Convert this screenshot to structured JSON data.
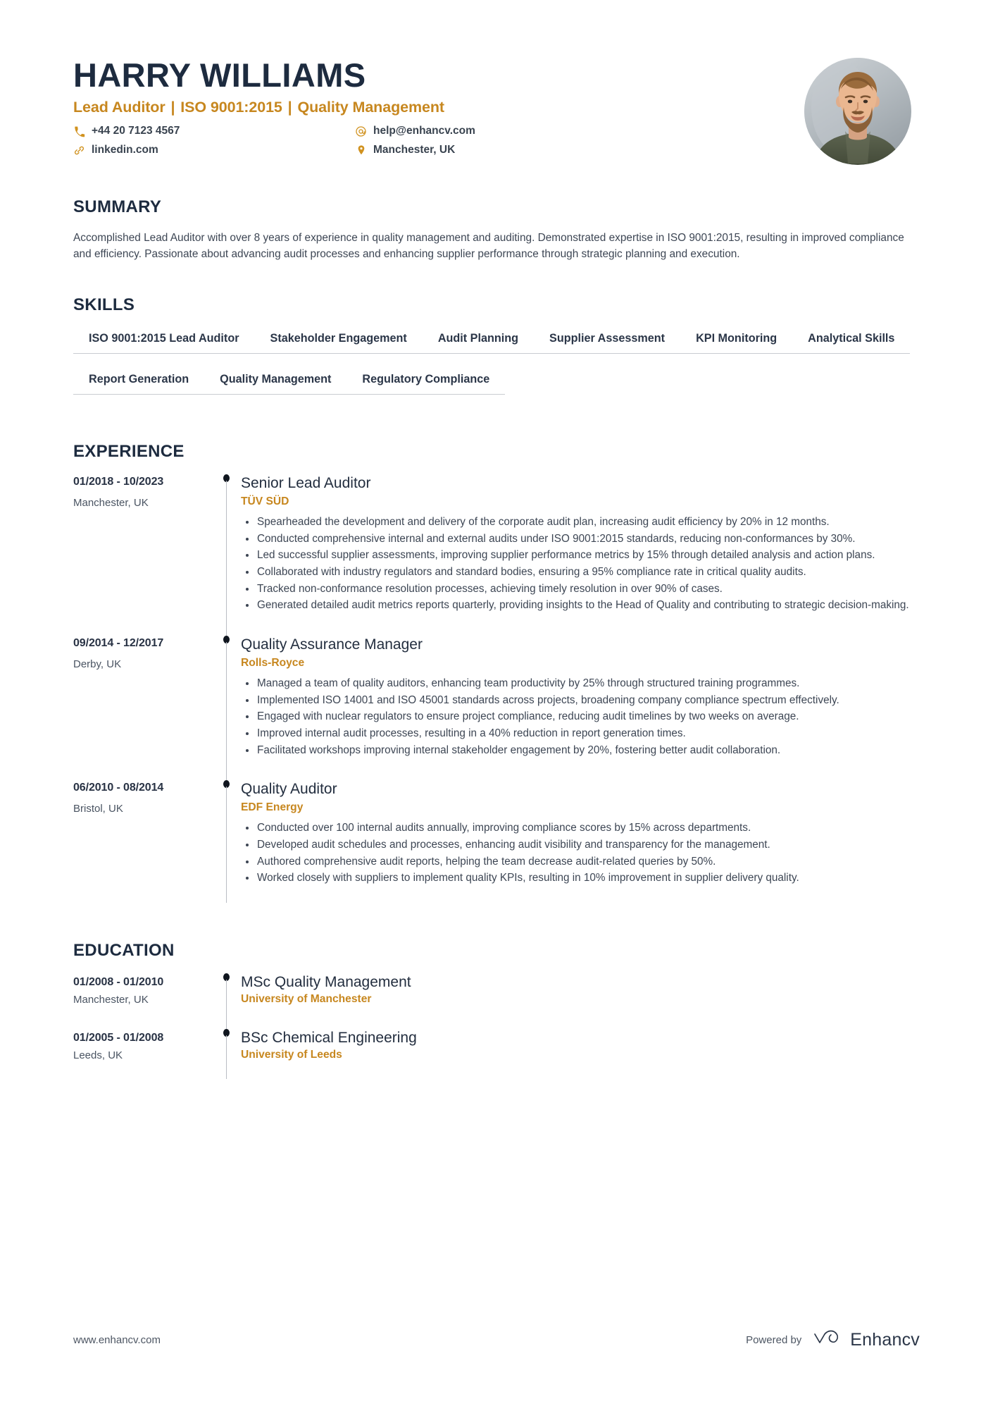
{
  "header": {
    "name": "HARRY WILLIAMS",
    "headline_parts": [
      "Lead Auditor",
      "ISO 9001:2015",
      "Quality Management"
    ],
    "headline_separator": "|",
    "contacts": [
      {
        "icon": "phone-icon",
        "value": "+44 20 7123 4567"
      },
      {
        "icon": "email-icon",
        "value": "help@enhancv.com"
      },
      {
        "icon": "link-icon",
        "value": "linkedin.com"
      },
      {
        "icon": "location-pin-icon",
        "value": "Manchester, UK"
      }
    ],
    "avatar_alt": "profile-photo"
  },
  "summary": {
    "title": "SUMMARY",
    "text": "Accomplished Lead Auditor with over 8 years of experience in quality management and auditing. Demonstrated expertise in ISO 9001:2015, resulting in improved compliance and efficiency. Passionate about advancing audit processes and enhancing supplier performance through strategic planning and execution."
  },
  "skills": {
    "title": "SKILLS",
    "items": [
      "ISO 9001:2015 Lead Auditor",
      "Stakeholder Engagement",
      "Audit Planning",
      "Supplier Assessment",
      "KPI Monitoring",
      "Analytical Skills",
      "Report Generation",
      "Quality Management",
      "Regulatory Compliance"
    ]
  },
  "experience": {
    "title": "EXPERIENCE",
    "entries": [
      {
        "date": "01/2018 - 10/2023",
        "location": "Manchester, UK",
        "role": "Senior Lead Auditor",
        "company": "TÜV SÜD",
        "bullets": [
          "Spearheaded the development and delivery of the corporate audit plan, increasing audit efficiency by 20% in 12 months.",
          "Conducted comprehensive internal and external audits under ISO 9001:2015 standards, reducing non-conformances by 30%.",
          "Led successful supplier assessments, improving supplier performance metrics by 15% through detailed analysis and action plans.",
          "Collaborated with industry regulators and standard bodies, ensuring a 95% compliance rate in critical quality audits.",
          "Tracked non-conformance resolution processes, achieving timely resolution in over 90% of cases.",
          "Generated detailed audit metrics reports quarterly, providing insights to the Head of Quality and contributing to strategic decision-making."
        ]
      },
      {
        "date": "09/2014 - 12/2017",
        "location": "Derby, UK",
        "role": "Quality Assurance Manager",
        "company": "Rolls-Royce",
        "bullets": [
          "Managed a team of quality auditors, enhancing team productivity by 25% through structured training programmes.",
          "Implemented ISO 14001 and ISO 45001 standards across projects, broadening company compliance spectrum effectively.",
          "Engaged with nuclear regulators to ensure project compliance, reducing audit timelines by two weeks on average.",
          "Improved internal audit processes, resulting in a 40% reduction in report generation times.",
          "Facilitated workshops improving internal stakeholder engagement by 20%, fostering better audit collaboration."
        ]
      },
      {
        "date": "06/2010 - 08/2014",
        "location": "Bristol, UK",
        "role": "Quality Auditor",
        "company": "EDF Energy",
        "bullets": [
          "Conducted over 100 internal audits annually, improving compliance scores by 15% across departments.",
          "Developed audit schedules and processes, enhancing audit visibility and transparency for the management.",
          "Authored comprehensive audit reports, helping the team decrease audit-related queries by 50%.",
          "Worked closely with suppliers to implement quality KPIs, resulting in 10% improvement in supplier delivery quality."
        ]
      }
    ]
  },
  "education": {
    "title": "EDUCATION",
    "entries": [
      {
        "date": "01/2008 - 01/2010",
        "location": "Manchester, UK",
        "degree": "MSc Quality Management",
        "institution": "University of Manchester"
      },
      {
        "date": "01/2005 - 01/2008",
        "location": "Leeds, UK",
        "degree": "BSc Chemical Engineering",
        "institution": "University of Leeds"
      }
    ]
  },
  "footer": {
    "website": "www.enhancv.com",
    "powered_by": "Powered by",
    "brand_name": "Enhancv"
  },
  "colors": {
    "accent": "#c7871f",
    "heading": "#1d2b3f",
    "body": "#3d4654",
    "rule": "#c9ccd1"
  }
}
